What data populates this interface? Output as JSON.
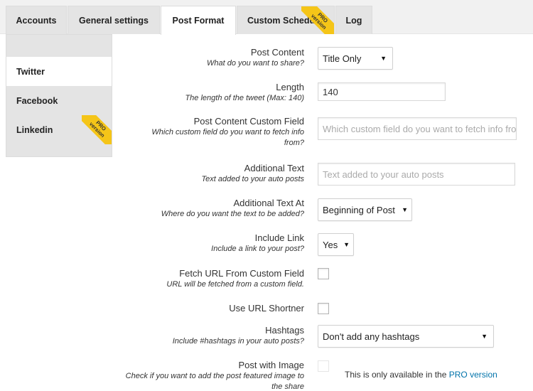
{
  "tabs": [
    {
      "label": "Accounts"
    },
    {
      "label": "General settings"
    },
    {
      "label": "Post Format"
    },
    {
      "label": "Custom Schedule"
    },
    {
      "label": "Log"
    }
  ],
  "pro_ribbon": {
    "line1": "PRO",
    "line2": "version"
  },
  "sidebar": {
    "items": [
      {
        "label": "Twitter"
      },
      {
        "label": "Facebook"
      },
      {
        "label": "Linkedin"
      }
    ]
  },
  "form": {
    "post_content": {
      "label": "Post Content",
      "desc": "What do you want to share?",
      "value": "Title Only"
    },
    "length": {
      "label": "Length",
      "desc": "The length of the tweet (Max: 140)",
      "value": "140"
    },
    "custom_field": {
      "label": "Post Content Custom Field",
      "desc": "Which custom field do you want to fetch info from?",
      "placeholder": "Which custom field do you want to fetch info from?"
    },
    "additional_text": {
      "label": "Additional Text",
      "desc": "Text added to your auto posts",
      "placeholder": "Text added to your auto posts"
    },
    "additional_text_at": {
      "label": "Additional Text At",
      "desc": "Where do you want the text to be added?",
      "value": "Beginning of Post"
    },
    "include_link": {
      "label": "Include Link",
      "desc": "Include a link to your post?",
      "value": "Yes"
    },
    "fetch_url": {
      "label": "Fetch URL From Custom Field",
      "desc": "URL will be fetched from a custom field."
    },
    "url_shortner": {
      "label": "Use URL Shortner"
    },
    "hashtags": {
      "label": "Hashtags",
      "desc": "Include #hashtags in your auto posts?",
      "value": "Don't add any hashtags"
    },
    "post_with_image": {
      "label": "Post with Image",
      "desc": "Check if you want to add the post featured image to the share",
      "note": "This is only available in the",
      "note_link": "PRO version"
    }
  }
}
